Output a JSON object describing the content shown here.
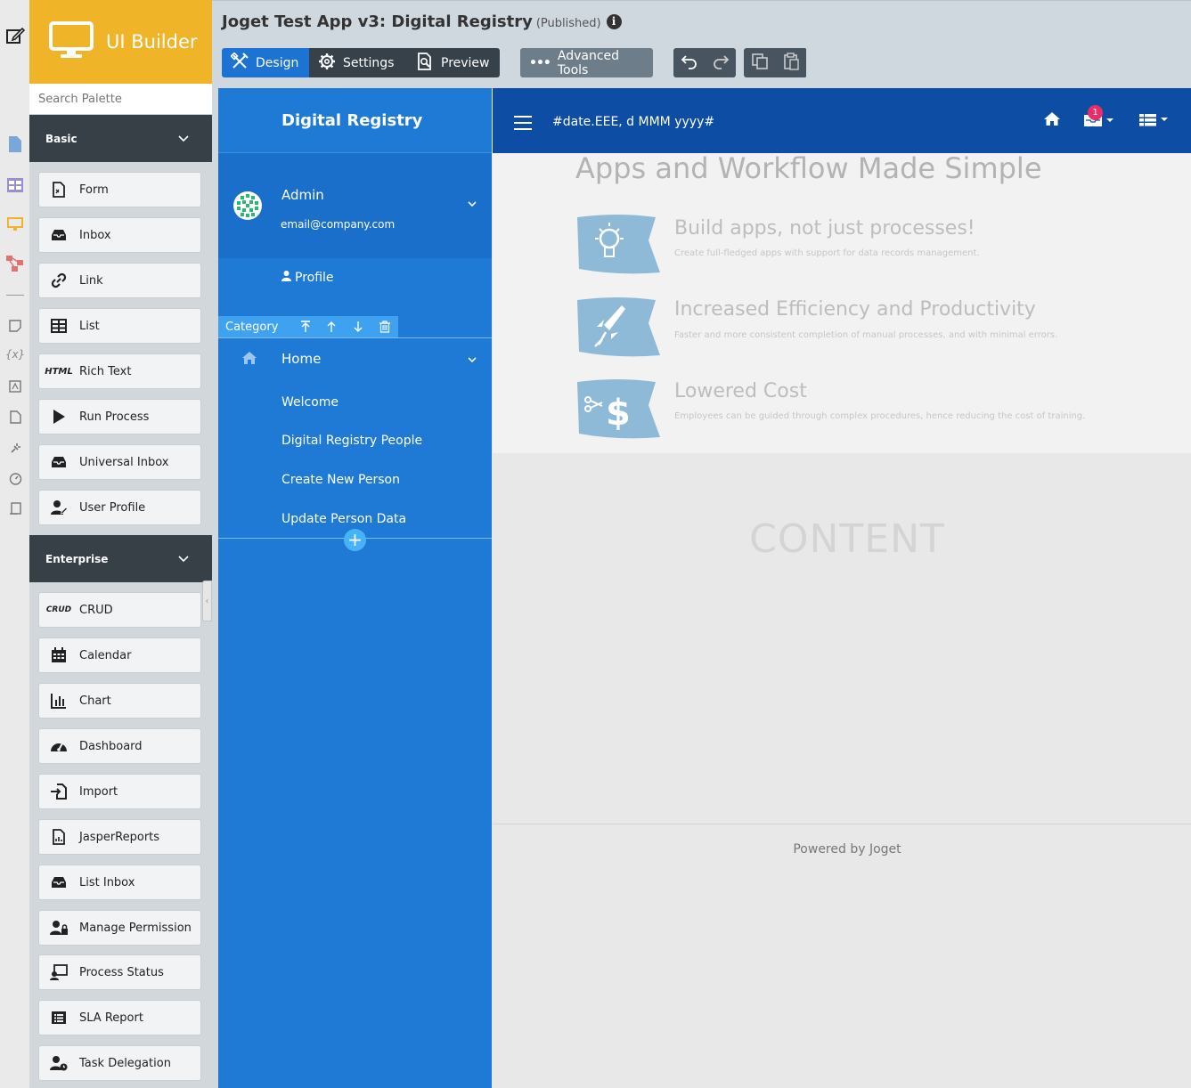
{
  "builder": {
    "brand": "UI Builder",
    "search_placeholder": "Search Palette"
  },
  "app": {
    "title": "Joget Test App v3: Digital Registry",
    "status": "(Published)"
  },
  "toolbar": {
    "design": "Design",
    "settings": "Settings",
    "preview": "Preview",
    "advanced_tools": "Advanced Tools"
  },
  "palette": {
    "basic_label": "Basic",
    "basic_items": [
      "Form",
      "Inbox",
      "Link",
      "List",
      "Rich Text",
      "Run Process",
      "Universal Inbox",
      "User Profile"
    ],
    "enterprise_label": "Enterprise",
    "enterprise_items": [
      "CRUD",
      "Calendar",
      "Chart",
      "Dashboard",
      "Import",
      "JasperReports",
      "List Inbox",
      "Manage Permission",
      "Process Status",
      "SLA Report",
      "Task Delegation"
    ],
    "icon_text": {
      "rich_text": "HTML",
      "crud": "CRUD"
    }
  },
  "sidebar": {
    "brand": "Digital Registry",
    "user_name": "Admin",
    "user_email": "email@company.com",
    "profile_label": "Profile",
    "category_toolbar_label": "Category",
    "category": "Home",
    "links": [
      "Welcome",
      "Digital Registry People",
      "Create New Person",
      "Update Person Data"
    ]
  },
  "header": {
    "date_format": "#date.EEE, d MMM yyyy#",
    "inbox_badge": "1"
  },
  "hero": {
    "title": "Apps and Workflow Made Simple",
    "features": [
      {
        "title": "Build apps, not just processes!",
        "desc": "Create full-fledged apps with support for data records management."
      },
      {
        "title": "Increased Efficiency and Productivity",
        "desc": "Faster and more consistent completion of manual processes, and with minimal errors."
      },
      {
        "title": "Lowered Cost",
        "desc": "Employees can be guided through complex procedures, hence reducing the cost of training."
      }
    ]
  },
  "content_placeholder": "CONTENT",
  "footer": "Powered by Joget",
  "colors": {
    "brand_orange": "#f0b429",
    "design_active": "#1c73d3",
    "sidebar_blue": "#1f7ad6",
    "header_blue": "#0d4da3",
    "badge_pink": "#e82e6a"
  }
}
